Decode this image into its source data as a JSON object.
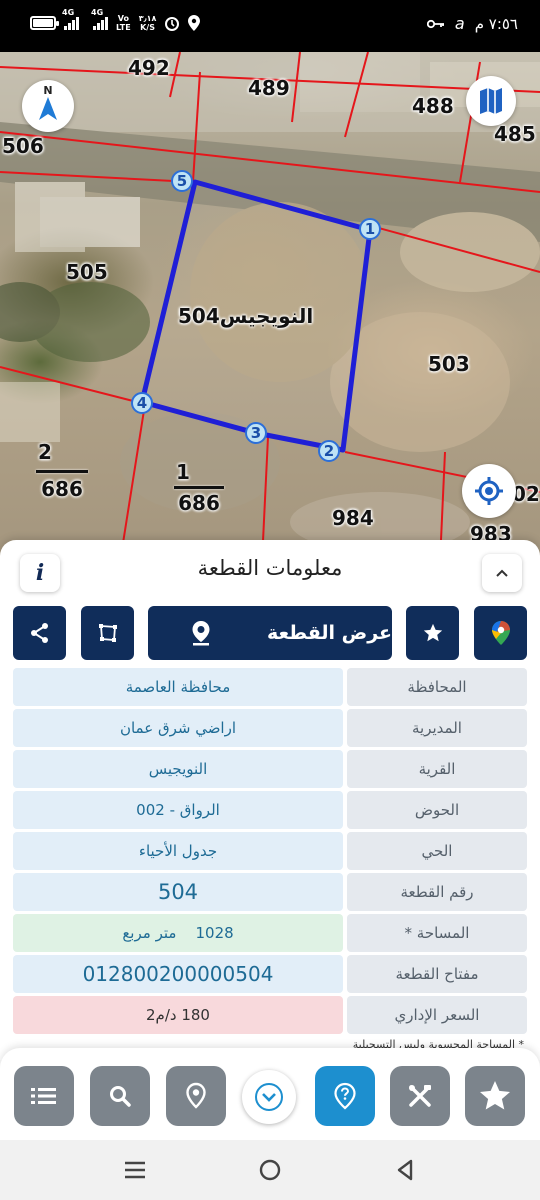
{
  "status_bar": {
    "time": "٧:٥٦ م",
    "net1": "4G",
    "net2": "4G",
    "volte_top": "Vo",
    "volte_bottom": "LTE",
    "speed_top": "٣٫١٨",
    "speed_bottom": "K/S"
  },
  "map": {
    "parcel_numbers": [
      "492",
      "489",
      "488",
      "485",
      "506",
      "505",
      "503",
      "984",
      "983",
      "02"
    ],
    "plot_label_name": "النويجيس",
    "plot_label_number": "504",
    "fractions": [
      {
        "top": "2",
        "bottom": "686"
      },
      {
        "top": "1",
        "bottom": "686"
      }
    ],
    "vertices": [
      "1",
      "2",
      "3",
      "4",
      "5"
    ],
    "compass_label": "N",
    "colors": {
      "boundary": "#e5161b",
      "plot_outline": "#1f1fd6"
    }
  },
  "sheet": {
    "title": "معلومات القطعة",
    "info_label": "i",
    "view_plot_label": "عرض القطعة",
    "rows": [
      {
        "label": "المحافظة",
        "value": "محافظة العاصمة"
      },
      {
        "label": "المديرية",
        "value": "اراضي شرق عمان"
      },
      {
        "label": "القرية",
        "value": "النويجيس"
      },
      {
        "label": "الحوض",
        "value": "الرواق - 002"
      },
      {
        "label": "الحي",
        "value": "جدول الأحياء"
      },
      {
        "label": "رقم القطعة",
        "value": "504"
      },
      {
        "label": "المساحة *",
        "value_number": "1028",
        "value_unit": "متر مربع"
      },
      {
        "label": "مفتاح القطعة",
        "value": "012800200000504"
      },
      {
        "label": "السعر الإداري",
        "value": "180 د/م2"
      }
    ],
    "footnote": "* المساحة المحسوبة وليس التسجيلية"
  },
  "toolbar": {
    "buttons": [
      "list-icon",
      "search-icon",
      "location-pin-icon",
      "chevron-down-icon",
      "help-icon",
      "tools-icon",
      "favorites-icon"
    ]
  },
  "colors": {
    "navy": "#102d5a",
    "accent": "#1d8fcf",
    "value_blue": "#1e6b95"
  }
}
